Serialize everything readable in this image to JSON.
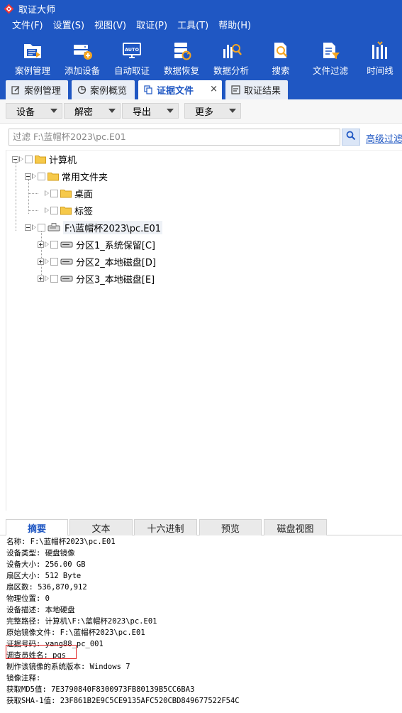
{
  "window": {
    "title": "取证大师"
  },
  "menu": [
    "文件(F)",
    "设置(S)",
    "视图(V)",
    "取证(P)",
    "工具(T)",
    "帮助(H)"
  ],
  "toolbar": [
    {
      "label": "案例管理",
      "icon": "case-management-icon"
    },
    {
      "label": "添加设备",
      "icon": "add-device-icon"
    },
    {
      "label": "自动取证",
      "icon": "auto-forensics-icon"
    },
    {
      "label": "数据恢复",
      "icon": "data-recovery-icon"
    },
    {
      "label": "数据分析",
      "icon": "data-analysis-icon"
    },
    {
      "label": "搜索",
      "icon": "search-icon"
    },
    {
      "label": "文件过滤",
      "icon": "file-filter-icon"
    },
    {
      "label": "时间线",
      "icon": "timeline-icon"
    }
  ],
  "auto_icon_text": "AUTO",
  "tabs": [
    {
      "label": "案例管理",
      "active": false
    },
    {
      "label": "案例概览",
      "active": false
    },
    {
      "label": "证据文件",
      "active": true,
      "close": "×"
    },
    {
      "label": "取证结果",
      "active": false
    }
  ],
  "subtoolbar": [
    "设备",
    "解密",
    "导出",
    "更多"
  ],
  "filter": {
    "placeholder": "过滤 F:\\蓝帽杯2023\\pc.E01",
    "advanced": "高级过滤"
  },
  "tree": [
    {
      "label": "计算机",
      "icon": "folder-icon"
    },
    {
      "label": "常用文件夹",
      "icon": "folder-icon"
    },
    {
      "label": "桌面",
      "icon": "folder-icon"
    },
    {
      "label": "标签",
      "icon": "folder-icon"
    },
    {
      "label": "F:\\蓝帽杯2023\\pc.E01",
      "icon": "disk-image-icon"
    },
    {
      "label": "分区1_系统保留[C]",
      "icon": "drive-icon"
    },
    {
      "label": "分区2_本地磁盘[D]",
      "icon": "drive-icon"
    },
    {
      "label": "分区3_本地磁盘[E]",
      "icon": "drive-icon"
    }
  ],
  "bottom_tabs": [
    {
      "label": "摘要",
      "active": true
    },
    {
      "label": "文本",
      "active": false
    },
    {
      "label": "十六进制",
      "active": false
    },
    {
      "label": "预览",
      "active": false
    },
    {
      "label": "磁盘视图",
      "active": false
    }
  ],
  "summary": [
    "名称: F:\\蓝帽杯2023\\pc.E01",
    "设备类型: 硬盘镜像",
    "设备大小: 256.00 GB",
    "扇区大小: 512 Byte",
    "扇区数: 536,870,912",
    "物理位置: 0",
    "设备描述: 本地硬盘",
    "完整路径: 计算机\\F:\\蓝帽杯2023\\pc.E01",
    "原始镜像文件: F:\\蓝帽杯2023\\pc.E01",
    "证据号码: yang88_pc_001",
    "调查员姓名: pgs",
    "制作该镜像的系统版本: Windows 7",
    "镜像注释:",
    "获取MD5值: 7E3790840F8300973FB80139B5CC6BA3",
    "获取SHA-1值: 23F861B2E9C5CE9135AFC520CBD849677522F54C"
  ],
  "colors": {
    "brand": "#1f57c3",
    "highlight": "#e02020"
  }
}
